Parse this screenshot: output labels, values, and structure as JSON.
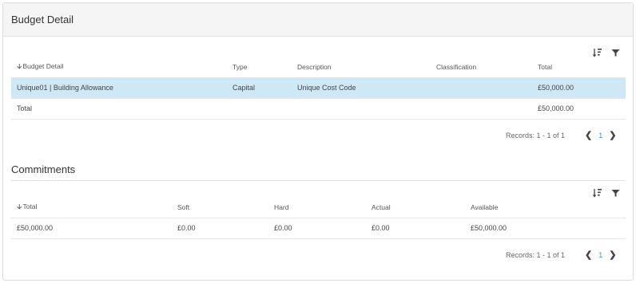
{
  "panel": {
    "title": "Budget Detail"
  },
  "budget_table": {
    "columns": [
      "Budget Detail",
      "Type",
      "Description",
      "Classification",
      "Total"
    ],
    "rows": [
      [
        "Unique01 | Building Allowance",
        "Capital",
        "Unique Cost Code",
        "",
        "£50,000.00"
      ]
    ],
    "total_row": [
      "Total",
      "",
      "",
      "",
      "£50,000.00"
    ],
    "pager": {
      "records": "Records: 1 - 1 of 1",
      "page": "1",
      "prev": "❮",
      "next": "❯"
    }
  },
  "commitments": {
    "title": "Commitments",
    "columns": [
      "Total",
      "Soft",
      "Hard",
      "Actual",
      "Available"
    ],
    "rows": [
      [
        "£50,000.00",
        "£0.00",
        "£0.00",
        "£0.00",
        "£50,000.00"
      ]
    ],
    "pager": {
      "records": "Records: 1 - 1 of 1",
      "page": "1",
      "prev": "❮",
      "next": "❯"
    }
  },
  "icons": {
    "sort": "sort-icon",
    "filter": "filter-icon"
  },
  "colors": {
    "selected_row": "#cfe8f6",
    "page_link": "#3a8fd4"
  }
}
